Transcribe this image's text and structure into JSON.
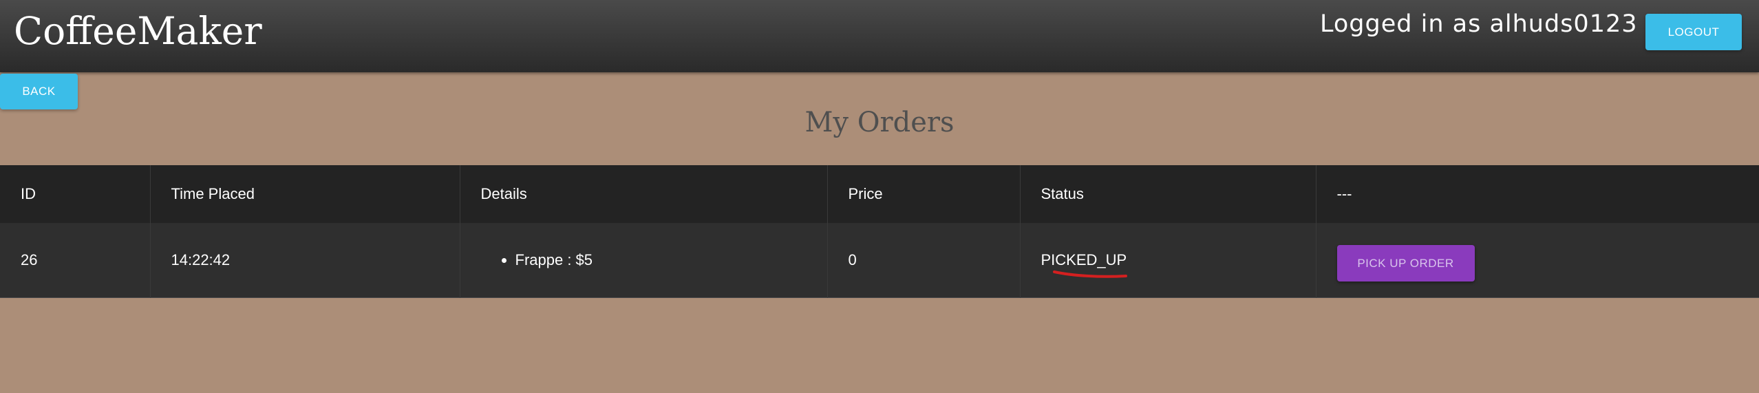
{
  "header": {
    "brand": "CoffeeMaker",
    "logged_in_text": "Logged in as alhuds0123",
    "logout_label": "LOGOUT"
  },
  "nav": {
    "back_label": "BACK"
  },
  "page": {
    "title": "My Orders"
  },
  "table": {
    "columns": [
      "ID",
      "Time Placed",
      "Details",
      "Price",
      "Status",
      "---"
    ],
    "rows": [
      {
        "id": "26",
        "time_placed": "14:22:42",
        "details": [
          "Frappe : $5"
        ],
        "price": "0",
        "status": "PICKED_UP",
        "action_label": "PICK UP ORDER"
      }
    ]
  },
  "colors": {
    "background": "#ac8e78",
    "accent_blue": "#3bbde8",
    "action_purple": "#8a3bbd",
    "annotation_red": "#d42020"
  }
}
